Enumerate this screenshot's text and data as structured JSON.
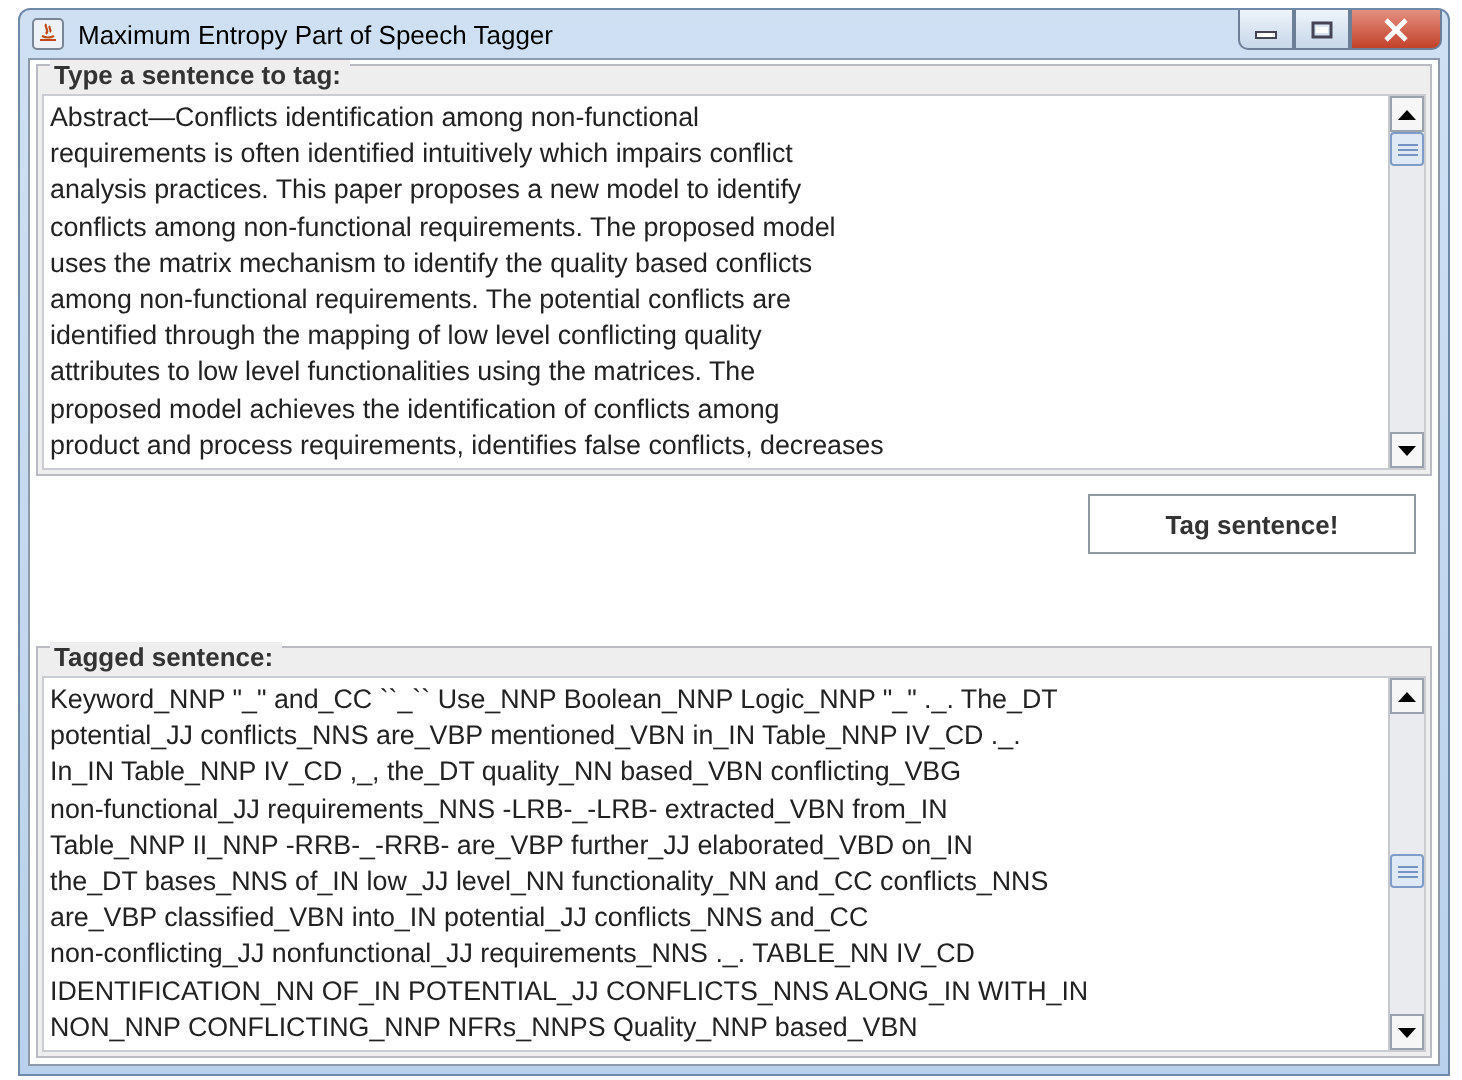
{
  "window": {
    "title": "Maximum Entropy Part of Speech Tagger"
  },
  "input_panel": {
    "title": "Type a sentence to tag:",
    "lines": [
      "Abstract—Conflicts identification among non-functional",
      "requirements is often identified intuitively which impairs conflict",
      "analysis practices. This paper proposes a new model to identify",
      "conflicts among non-functional requirements. The proposed model",
      "uses the matrix mechanism to identify the quality based conflicts",
      "among non-functional requirements. The potential conflicts are",
      "identified through the mapping of low level conflicting quality",
      "attributes to low level functionalities using the matrices. The",
      "proposed model achieves the identification of conflicts among",
      "product and process requirements, identifies false conflicts, decreases"
    ]
  },
  "button": "Tag sentence!",
  "output_panel": {
    "title": "Tagged sentence:",
    "lines": [
      "Keyword_NNP \"_\" and_CC ``_`` Use_NNP Boolean_NNP Logic_NNP \"_\" ._. The_DT",
      "potential_JJ conflicts_NNS are_VBP mentioned_VBN in_IN Table_NNP IV_CD ._.",
      "In_IN Table_NNP IV_CD ,_, the_DT quality_NN based_VBN conflicting_VBG",
      "non-functional_JJ requirements_NNS -LRB-_-LRB- extracted_VBN from_IN",
      "Table_NNP II_NNP -RRB-_-RRB- are_VBP further_JJ elaborated_VBD on_IN",
      "the_DT bases_NNS of_IN low_JJ level_NN functionality_NN and_CC conflicts_NNS",
      "are_VBP classified_VBN into_IN potential_JJ conflicts_NNS and_CC",
      "non-conflicting_JJ nonfunctional_JJ requirements_NNS ._. TABLE_NN IV_CD",
      "IDENTIFICATION_NN OF_IN POTENTIAL_JJ CONFLICTS_NNS ALONG_IN WITH_IN",
      "NON_NNP CONFLICTING_NNP NFRs_NNPS Quality_NNP based_VBN"
    ]
  }
}
